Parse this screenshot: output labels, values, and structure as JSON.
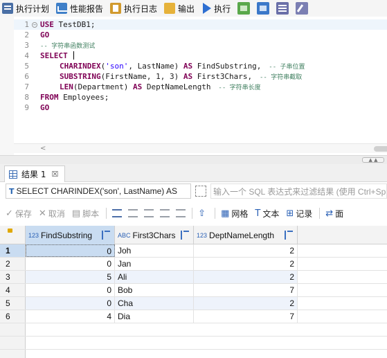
{
  "toolbar": {
    "items": [
      {
        "label": "执行计划"
      },
      {
        "label": "性能报告"
      },
      {
        "label": "执行日志"
      },
      {
        "label": "输出"
      },
      {
        "label": "执行"
      }
    ]
  },
  "editor": {
    "line_numbers": [
      "1",
      "2",
      "3",
      "4",
      "5",
      "6",
      "7",
      "8",
      "9"
    ],
    "lines": [
      {
        "kw": "USE",
        "rest": " TestDB1;"
      },
      {
        "kw": "GO",
        "rest": ""
      },
      {
        "comment": "-- 字符串函数测试"
      },
      {
        "kw": "SELECT",
        "rest": " "
      },
      {
        "fn": "CHARINDEX",
        "a": "(",
        "str": "'son'",
        "b": ", LastName) ",
        "kw2": "AS",
        "c": " FindSubstring,",
        "comment": "  -- 子串位置"
      },
      {
        "fn": "SUBSTRING",
        "a": "(FirstName, 1, 3) ",
        "kw2": "AS",
        "c": " First3Chars,",
        "comment": "  -- 字符串截取"
      },
      {
        "fn": "LEN",
        "a": "(Department) ",
        "kw2": "AS",
        "c": " DeptNameLength",
        "comment": "  -- 字符串长度"
      },
      {
        "kw": "FROM",
        "rest": " Employees;"
      },
      {
        "kw": "GO",
        "rest": ""
      }
    ],
    "scroll_arrow": "<"
  },
  "results_tab": {
    "label": "结果 1",
    "close": "☒"
  },
  "filter": {
    "sql_icon": "T",
    "sql_text": "SELECT CHARINDEX('son', LastName) AS",
    "placeholder": "输入一个 SQL 表达式来过滤结果 (使用 Ctrl+Sp"
  },
  "actions": {
    "save": "保存",
    "cancel": "取消",
    "script": "脚本",
    "grid": "网格",
    "text": "文本",
    "record": "记录",
    "panel": "面"
  },
  "grid": {
    "columns": [
      {
        "type": "123",
        "name": "FindSubstring"
      },
      {
        "type": "ABC",
        "name": "First3Chars"
      },
      {
        "type": "123",
        "name": "DeptNameLength"
      }
    ],
    "rows": [
      {
        "n": "1",
        "cells": [
          "0",
          "Joh",
          "2"
        ]
      },
      {
        "n": "2",
        "cells": [
          "0",
          "Jan",
          "2"
        ]
      },
      {
        "n": "3",
        "cells": [
          "5",
          "Ali",
          "2"
        ]
      },
      {
        "n": "4",
        "cells": [
          "0",
          "Bob",
          "7"
        ]
      },
      {
        "n": "5",
        "cells": [
          "0",
          "Cha",
          "2"
        ]
      },
      {
        "n": "6",
        "cells": [
          "4",
          "Dia",
          "7"
        ]
      }
    ]
  }
}
